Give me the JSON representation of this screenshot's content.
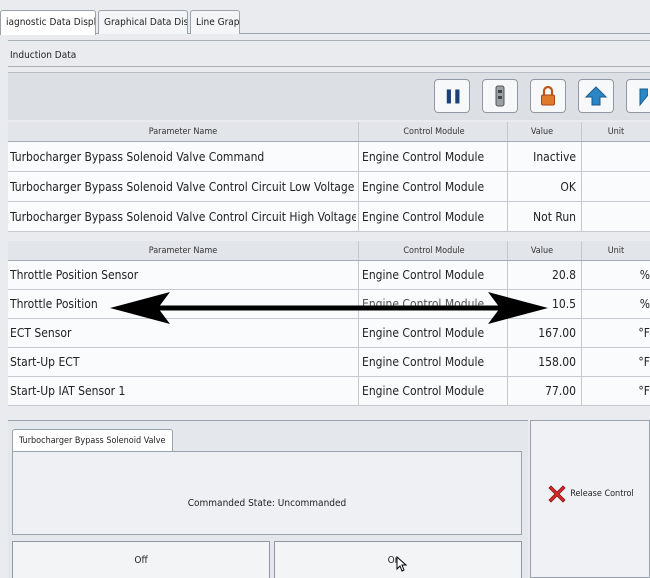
{
  "tabs": [
    "iagnostic Data Display",
    "Graphical Data Display",
    "Line Graph"
  ],
  "section_title": "Induction Data",
  "toolbar": {
    "icons": [
      "pause-icon",
      "snapshot-icon",
      "lock-icon",
      "up-arrow-icon",
      "down-arrow-icon"
    ],
    "pause_glyph": "❚❚"
  },
  "headers": {
    "parameter": "Parameter Name",
    "module": "Control Module",
    "value": "Value",
    "unit": "Unit"
  },
  "table1": [
    {
      "name": "Turbocharger Bypass Solenoid Valve Command",
      "module": "Engine Control Module",
      "value": "Inactive",
      "unit": ""
    },
    {
      "name": "Turbocharger Bypass Solenoid Valve Control Circuit Low Voltage Test ...",
      "module": "Engine Control Module",
      "value": "OK",
      "unit": ""
    },
    {
      "name": "Turbocharger Bypass Solenoid Valve Control Circuit High Voltage Test ...",
      "module": "Engine Control Module",
      "value": "Not Run",
      "unit": ""
    }
  ],
  "table2": [
    {
      "name": "Throttle Position Sensor",
      "module": "Engine Control Module",
      "value": "20.8",
      "unit": "%"
    },
    {
      "name": "Throttle Position",
      "module": "Engine Control Module",
      "value": "10.5",
      "unit": "%"
    },
    {
      "name": "ECT Sensor",
      "module": "Engine Control Module",
      "value": "167.00",
      "unit": "°F"
    },
    {
      "name": "Start-Up ECT",
      "module": "Engine Control Module",
      "value": "158.00",
      "unit": "°F"
    },
    {
      "name": "Start-Up IAT Sensor 1",
      "module": "Engine Control Module",
      "value": "77.00",
      "unit": "°F"
    }
  ],
  "control": {
    "tab": "Turbocharger Bypass Solenoid Valve",
    "commanded_state": "Commanded State: Uncommanded",
    "off_label": "Off",
    "on_label": "On",
    "release_label": "Release Control"
  },
  "colors": {
    "arrow": "#000000",
    "release_x": "#d62b2b",
    "lock": "#d9661f",
    "nav": "#2b86c5"
  }
}
